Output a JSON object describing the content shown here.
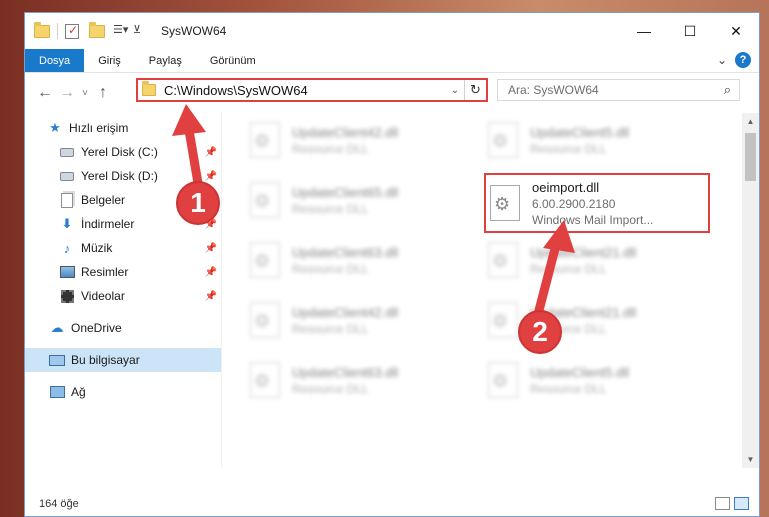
{
  "window": {
    "title": "SysWOW64",
    "controls": {
      "minimize": "—",
      "maximize": "☐",
      "close": "✕"
    }
  },
  "ribbon": {
    "tabs": [
      "Dosya",
      "Giriş",
      "Paylaş",
      "Görünüm"
    ],
    "active_tab": "Dosya",
    "expand_glyph": "⌄",
    "help_glyph": "?"
  },
  "address": {
    "path": "C:\\Windows\\SysWOW64",
    "back_glyph": "←",
    "forward_glyph": "→",
    "recent_glyph": "˅",
    "up_glyph": "↑",
    "dropdown_glyph": "⌄",
    "refresh_glyph": "↻"
  },
  "search": {
    "placeholder": "Ara: SysWOW64",
    "icon": "search-icon"
  },
  "navigation": {
    "items": [
      {
        "label": "Hızlı erişim",
        "icon": "star-icon",
        "pinned": false
      },
      {
        "label": "Yerel Disk (C:)",
        "icon": "disk-icon",
        "pinned": true
      },
      {
        "label": "Yerel Disk (D:)",
        "icon": "disk-icon",
        "pinned": true
      },
      {
        "label": "Belgeler",
        "icon": "documents-icon",
        "pinned": true
      },
      {
        "label": "İndirmeler",
        "icon": "download-icon",
        "pinned": true
      },
      {
        "label": "Müzik",
        "icon": "music-icon",
        "pinned": true
      },
      {
        "label": "Resimler",
        "icon": "pictures-icon",
        "pinned": true
      },
      {
        "label": "Videolar",
        "icon": "videos-icon",
        "pinned": true
      },
      {
        "label": "OneDrive",
        "icon": "cloud-icon",
        "pinned": false
      },
      {
        "label": "Bu bilgisayar",
        "icon": "computer-icon",
        "pinned": false,
        "selected": true
      },
      {
        "label": "Ağ",
        "icon": "network-icon",
        "pinned": false
      }
    ],
    "pin_glyph": "📌"
  },
  "files": [
    {
      "name": "UpdateClient42.dll",
      "desc": "Resource DLL",
      "blurred": true
    },
    {
      "name": "UpdateClient5.dll",
      "desc": "Resource DLL",
      "blurred": true
    },
    {
      "name": "UpdateClient65.dll",
      "desc": "Resource DLL",
      "blurred": true
    },
    {
      "name": "oeimport.dll",
      "version": "6.00.2900.2180",
      "desc": "Windows Mail Import...",
      "blurred": false,
      "highlighted": true
    },
    {
      "name": "UpdateClient63.dll",
      "desc": "Resource DLL",
      "blurred": true
    },
    {
      "name": "UpdateClient21.dll",
      "desc": "Resource DLL",
      "blurred": true
    },
    {
      "name": "UpdateClient42.dll",
      "desc": "Resource DLL",
      "blurred": true
    },
    {
      "name": "UpdateClient21.dll",
      "desc": "Resource DLL",
      "blurred": true
    },
    {
      "name": "UpdateClient63.dll",
      "desc": "Resource DLL",
      "blurred": true
    },
    {
      "name": "UpdateClient5.dll",
      "desc": "Resource DLL",
      "blurred": true
    }
  ],
  "scrollbar": {
    "up": "▲",
    "down": "▼"
  },
  "status": {
    "count": "164 öğe"
  },
  "annotations": {
    "badge1": "1",
    "badge2": "2",
    "color": "#e04040"
  },
  "colors": {
    "accent": "#1979ca",
    "highlight": "#e04040",
    "selection": "#cce4f7"
  }
}
